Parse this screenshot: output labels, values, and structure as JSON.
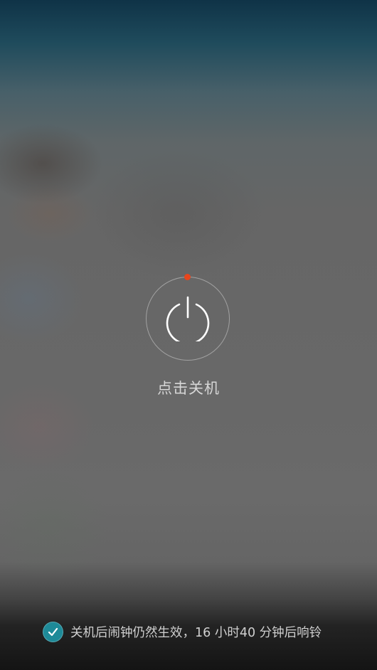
{
  "power_menu": {
    "tap_to_power_off_label": "点击关机",
    "indicator_color": "#e8451c"
  },
  "alarm_notice": {
    "checked": true,
    "text": "关机后闹钟仍然生效，16 小时40 分钟后响铃",
    "check_color": "#1e8a98"
  },
  "icons": {
    "power": "power-icon",
    "check": "check-icon"
  }
}
